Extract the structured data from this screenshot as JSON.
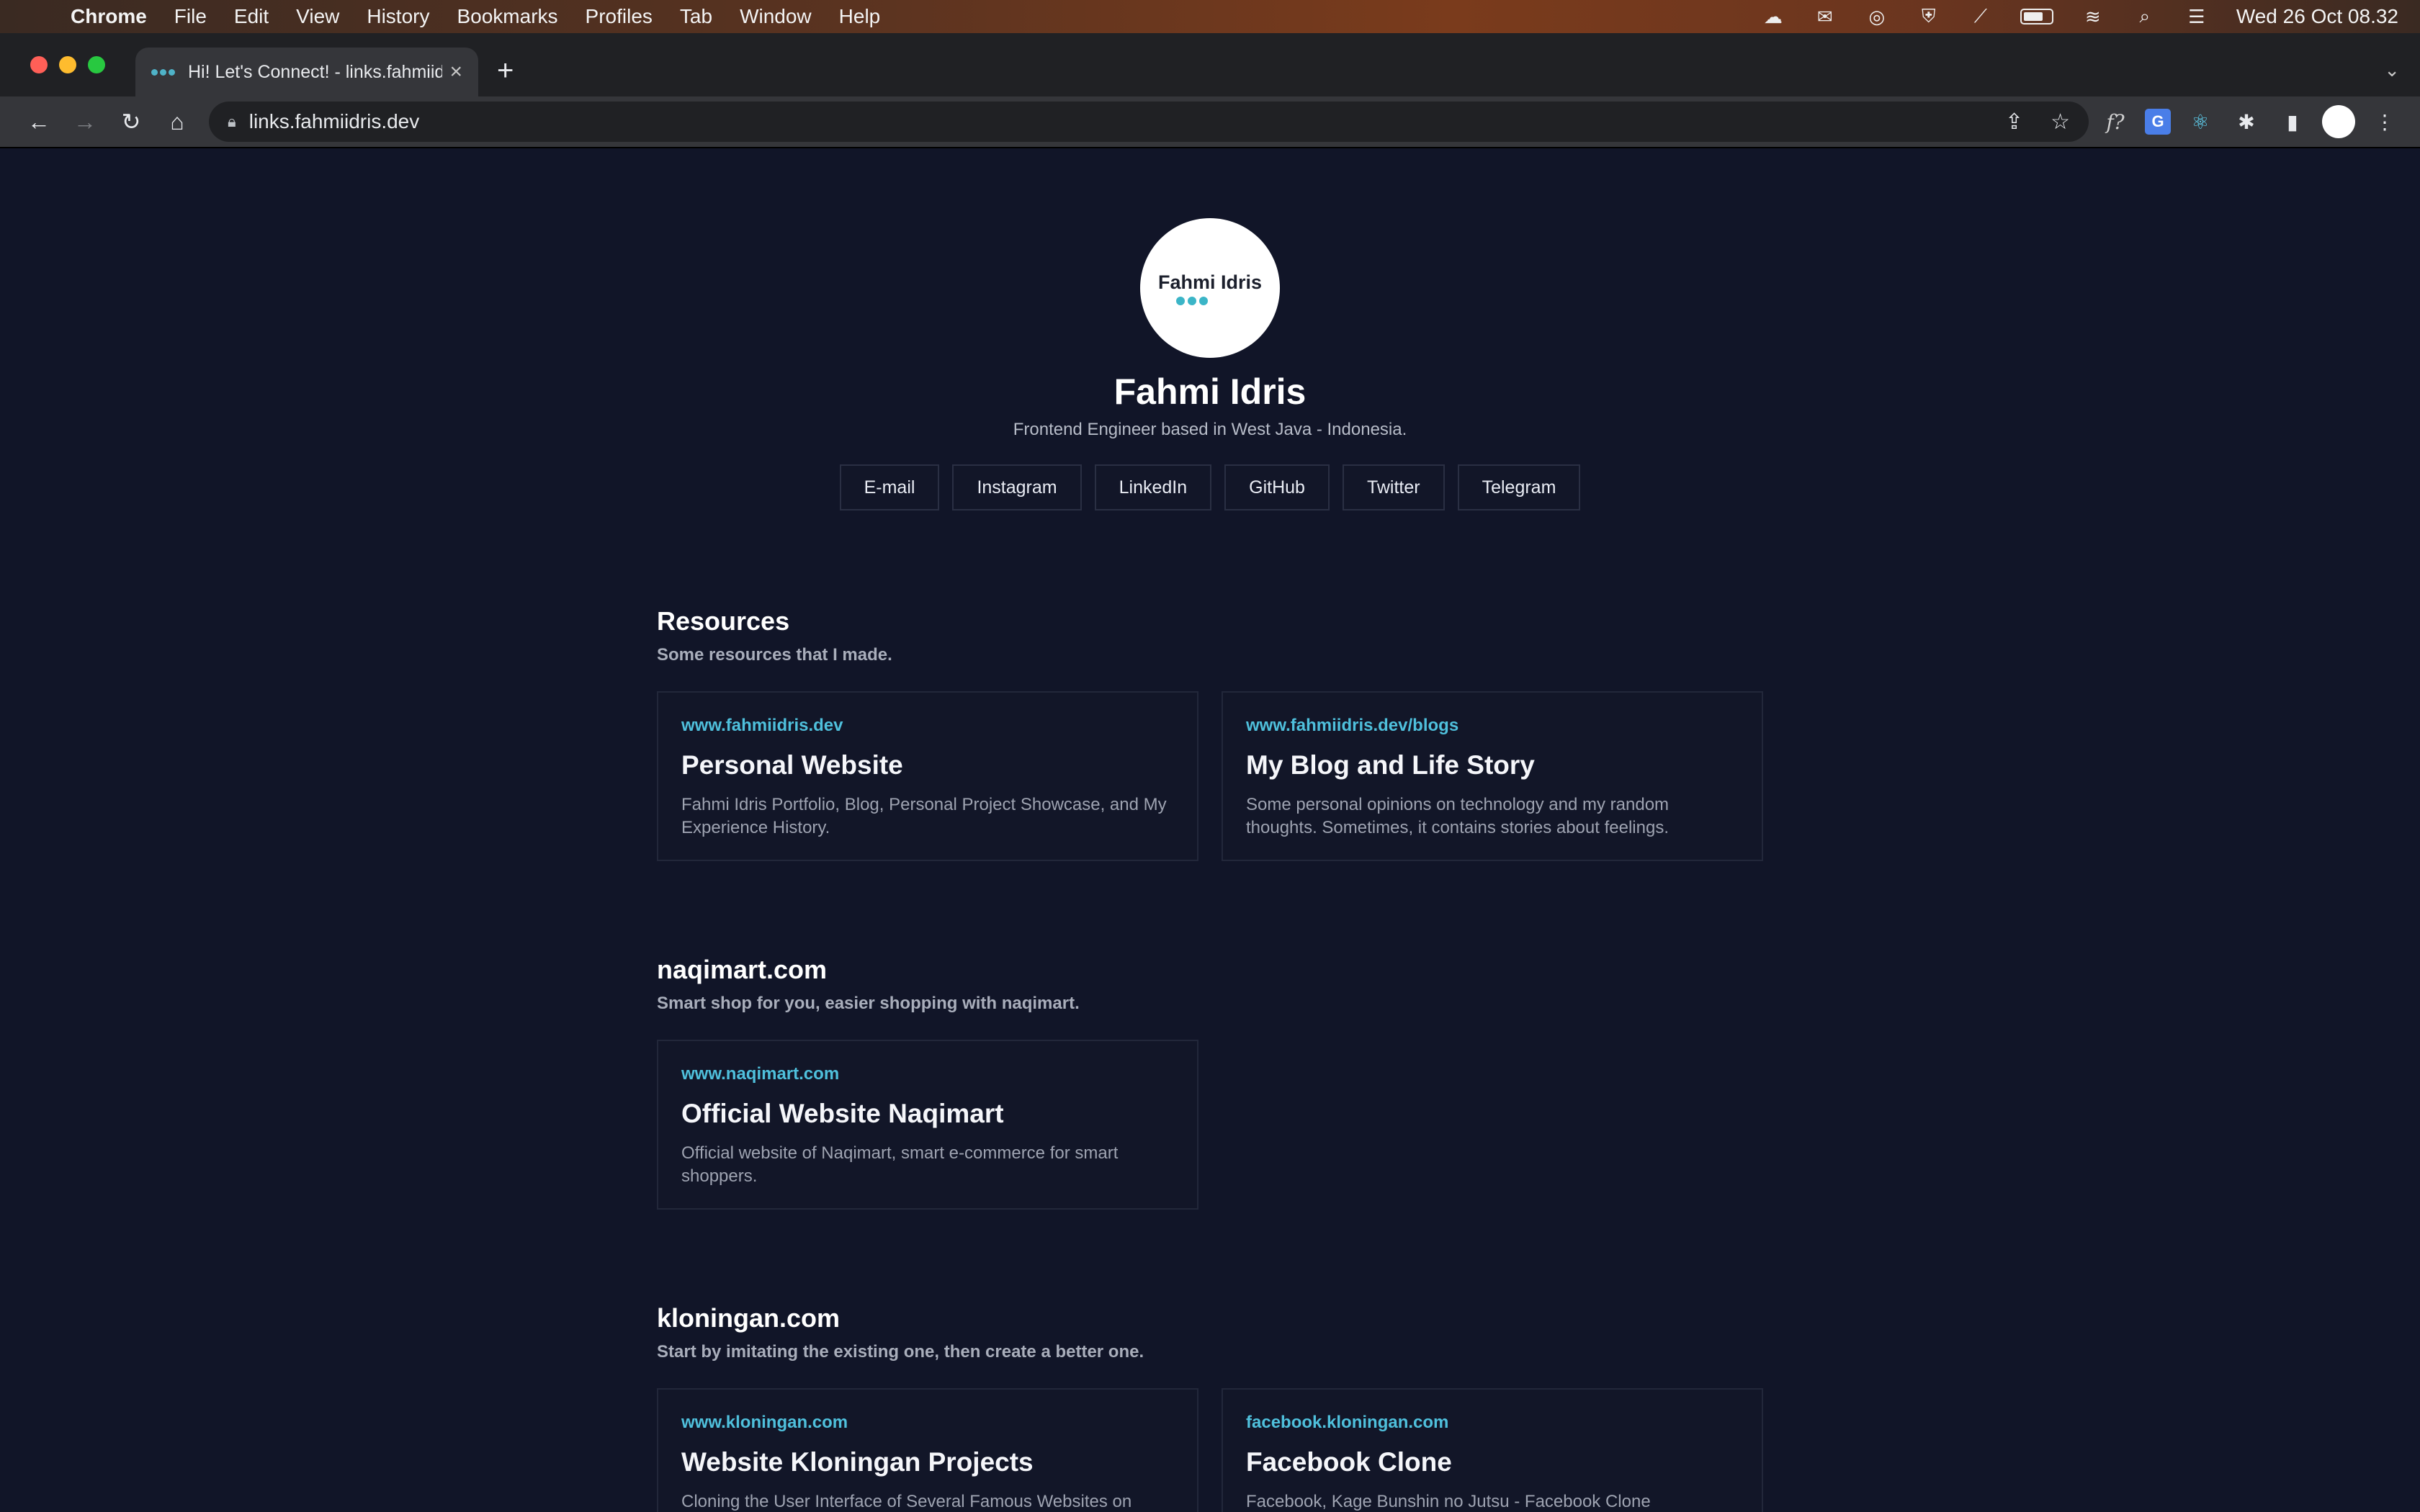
{
  "menubar": {
    "app": "Chrome",
    "items": [
      "File",
      "Edit",
      "View",
      "History",
      "Bookmarks",
      "Profiles",
      "Tab",
      "Window",
      "Help"
    ],
    "clock": "Wed 26 Oct  08.32"
  },
  "browser": {
    "tab_title": "Hi! Let's Connect! - links.fahmiidris.dev",
    "url": "links.fahmiidris.dev"
  },
  "profile": {
    "logo_text": "Fahmi Idris",
    "name": "Fahmi Idris",
    "tagline": "Frontend Engineer based in West Java - Indonesia."
  },
  "social": [
    "E-mail",
    "Instagram",
    "LinkedIn",
    "GitHub",
    "Twitter",
    "Telegram"
  ],
  "sections": [
    {
      "title": "Resources",
      "desc": "Some resources that I made.",
      "cards": [
        {
          "url": "www.fahmiidris.dev",
          "title": "Personal Website",
          "desc": "Fahmi Idris Portfolio, Blog, Personal Project Showcase, and My Experience History."
        },
        {
          "url": "www.fahmiidris.dev/blogs",
          "title": "My Blog and Life Story",
          "desc": "Some personal opinions on technology and my random thoughts. Sometimes, it contains stories about feelings."
        }
      ]
    },
    {
      "title": "naqimart.com",
      "desc": "Smart shop for you, easier shopping with naqimart.",
      "cards": [
        {
          "url": "www.naqimart.com",
          "title": "Official Website Naqimart",
          "desc": "Official website of Naqimart, smart e-commerce for smart shoppers."
        }
      ]
    },
    {
      "title": "kloningan.com",
      "desc": "Start by imitating the existing one, then create a better one.",
      "cards": [
        {
          "url": "www.kloningan.com",
          "title": "Website Kloningan Projects",
          "desc": "Cloning the User Interface of Several Famous Websites on"
        },
        {
          "url": "facebook.kloningan.com",
          "title": "Facebook Clone",
          "desc": "Facebook, Kage Bunshin no Jutsu - Facebook Clone"
        }
      ]
    }
  ]
}
